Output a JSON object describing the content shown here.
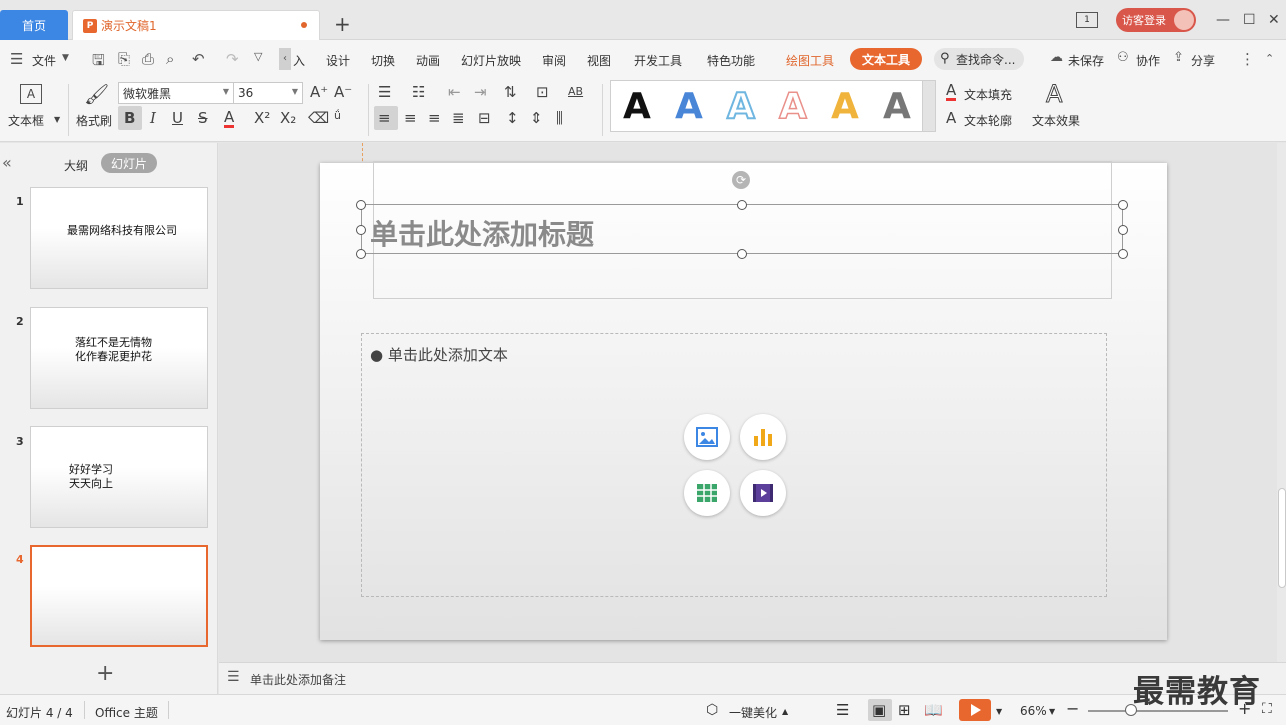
{
  "titlebar": {
    "home_tab": "首页",
    "doc_tab": "演示文稿1",
    "add_tab": "+",
    "page_badge": "1",
    "visitor_login": "访客登录"
  },
  "menubar": {
    "file": "文件",
    "items": [
      "入",
      "设计",
      "切换",
      "动画",
      "幻灯片放映",
      "审阅",
      "视图",
      "开发工具",
      "特色功能"
    ],
    "drawing_tools": "绘图工具",
    "text_tools": "文本工具",
    "search_placeholder": "查找命令...",
    "unsaved": "未保存",
    "collaborate": "协作",
    "share": "分享"
  },
  "ribbon": {
    "textbox": "文本框",
    "format_painter": "格式刷",
    "font_name": "微软雅黑",
    "font_size": "36",
    "style_letter": "A",
    "text_fill": "文本填充",
    "text_outline": "文本轮廓",
    "text_effect": "文本效果",
    "style_colors": [
      "#111111",
      "#4a86d8",
      "#6fb6e0",
      "#e9908a",
      "#f0b43c",
      "#777777"
    ]
  },
  "leftpanel": {
    "outline_tab": "大纲",
    "slides_tab": "幻灯片",
    "slides": [
      {
        "num": "1",
        "text": "最需网络科技有限公司"
      },
      {
        "num": "2",
        "text": "落红不是无情物\n化作春泥更护花"
      },
      {
        "num": "3",
        "text": "好好学习\n天天向上"
      },
      {
        "num": "4",
        "text": ""
      }
    ]
  },
  "slide": {
    "title_placeholder": "单击此处添加标题",
    "content_placeholder": "单击此处添加文本"
  },
  "notes": {
    "placeholder": "单击此处添加备注"
  },
  "statusbar": {
    "slide_counter": "幻灯片 4 / 4",
    "theme": "Office 主题",
    "beautify": "一键美化",
    "zoom": "66%"
  },
  "watermark": "最需教育",
  "colors": {
    "accent": "#e8672f",
    "home_tab": "#3d87e4",
    "visitor": "#d8564a"
  }
}
